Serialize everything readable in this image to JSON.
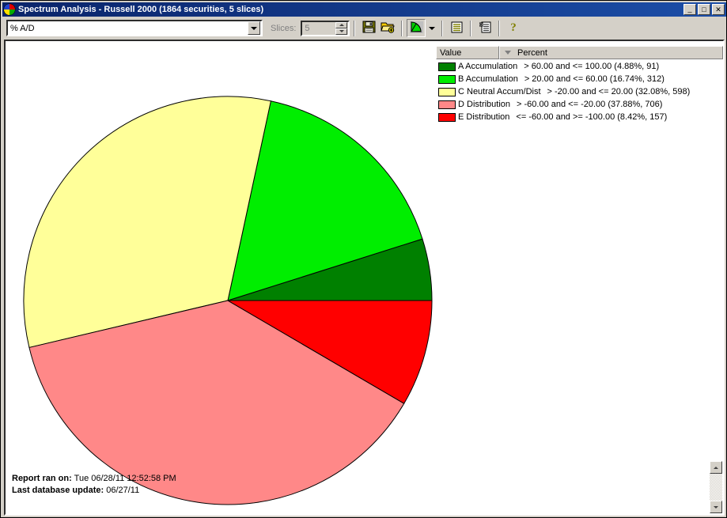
{
  "window": {
    "title": "Spectrum Analysis - Russell 2000 (1864 securities, 5 slices)",
    "icon": "pie-chart-icon",
    "minimize_label": "_",
    "maximize_label": "□",
    "close_label": "✕"
  },
  "toolbar": {
    "indicator_value": "% A/D",
    "indicator_placeholder": "% A/D",
    "slices_label": "Slices:",
    "slices_value": "5",
    "buttons": [
      {
        "name": "save-button",
        "icon": "floppy-disk-icon"
      },
      {
        "name": "open-button",
        "icon": "open-folder-icon"
      },
      {
        "name": "chart-type-button",
        "icon": "pie-chart-icon"
      },
      {
        "name": "chart-type-dropdown",
        "icon": "chevron-down-icon"
      },
      {
        "name": "report-view-button",
        "icon": "list-view-icon"
      },
      {
        "name": "detail-report-button",
        "icon": "detail-list-icon"
      },
      {
        "name": "help-button",
        "icon": "question-mark-icon"
      }
    ]
  },
  "legend": {
    "columns": [
      "Value",
      "Percent"
    ],
    "sort_indicator": "descending",
    "rows": [
      {
        "color": "#008000",
        "name": "A Accumulation",
        "detail": "> 60.00 and <= 100.00 (4.88%, 91)"
      },
      {
        "color": "#00ee00",
        "name": "B Accumulation",
        "detail": "> 20.00 and <= 60.00 (16.74%, 312)"
      },
      {
        "color": "#ffff99",
        "name": "C Neutral Accum/Dist",
        "detail": "> -20.00 and <= 20.00 (32.08%, 598)"
      },
      {
        "color": "#ff8888",
        "name": "D Distribution",
        "detail": "> -60.00 and <= -20.00 (37.88%, 706)"
      },
      {
        "color": "#ff0000",
        "name": "E Distribution",
        "detail": "<= -60.00 and >= -100.00 (8.42%, 157)"
      }
    ]
  },
  "footer": {
    "report_ran_label": "Report ran on:",
    "report_ran_value": "Tue 06/28/11 12:52:58 PM",
    "last_update_label": "Last database update:",
    "last_update_value": "06/27/11"
  },
  "chart_data": {
    "type": "pie",
    "title": "Spectrum Analysis - Russell 2000",
    "labels": [
      "A Accumulation",
      "B Accumulation",
      "C Neutral Accum/Dist",
      "D Distribution",
      "E Distribution"
    ],
    "values": [
      4.88,
      16.74,
      32.08,
      37.88,
      8.42
    ],
    "counts": [
      91,
      312,
      598,
      706,
      157
    ],
    "colors": [
      "#008000",
      "#00ee00",
      "#ffff99",
      "#ff8888",
      "#ff0000"
    ],
    "ranges": [
      "> 60.00 and <= 100.00",
      "> 20.00 and <= 60.00",
      "> -20.00 and <= 20.00",
      "> -60.00 and <= -20.00",
      "<= -60.00 and >= -100.00"
    ],
    "total_securities": 1864,
    "slices": 5,
    "start_angle_deg": 0,
    "direction": "counterclockwise",
    "legend_position": "top-right",
    "units": "percent"
  }
}
